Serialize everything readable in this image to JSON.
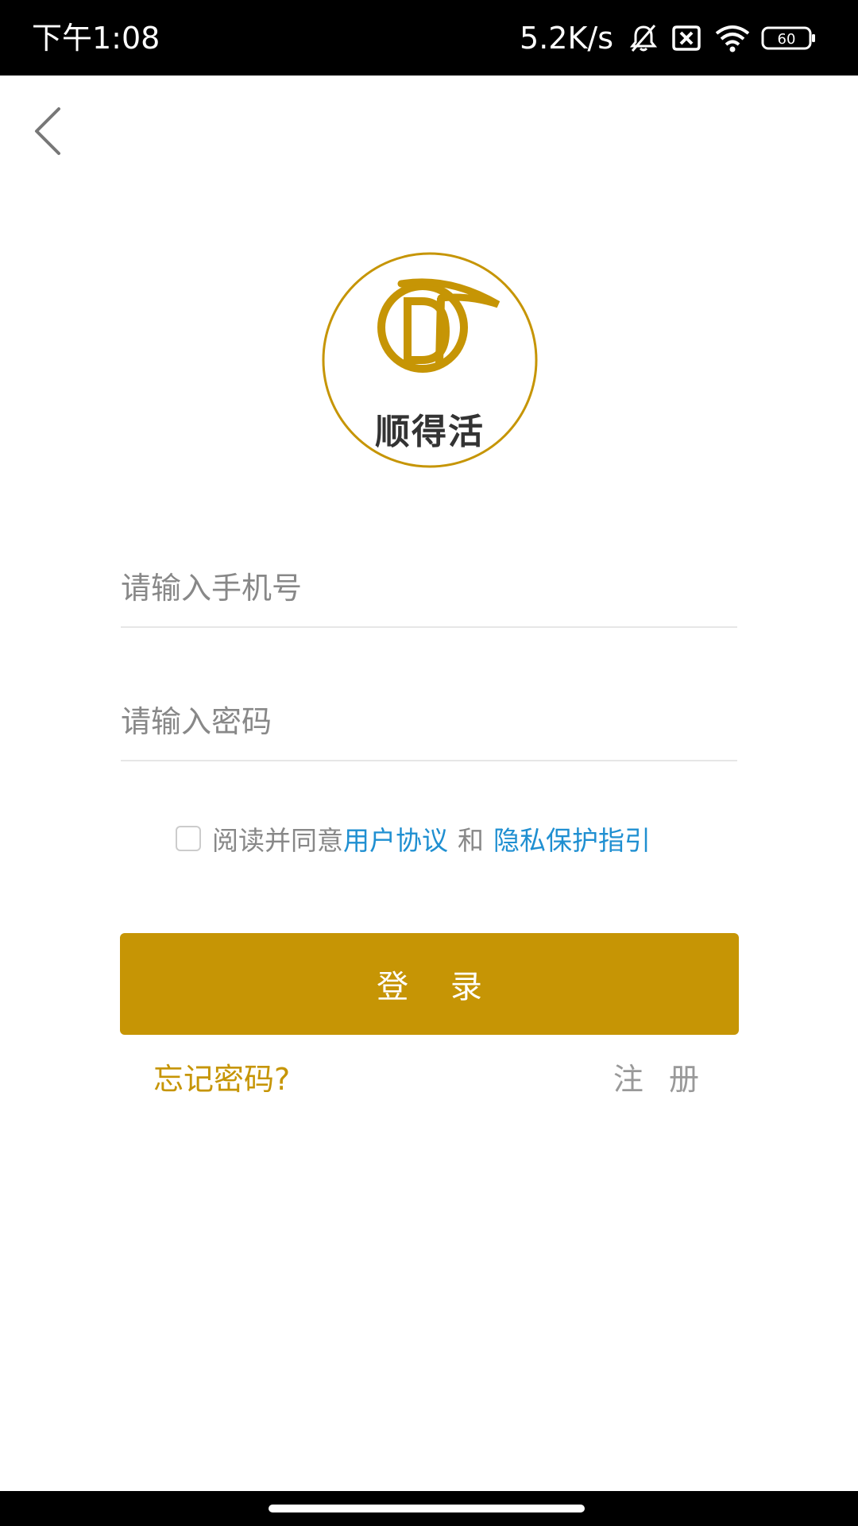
{
  "status_bar": {
    "time": "下午1:08",
    "net_speed": "5.2K/s",
    "battery": "60",
    "icons": [
      "bell-off-icon",
      "sim-none-icon",
      "wifi-icon",
      "battery-icon"
    ]
  },
  "nav": {
    "back_icon": "chevron-left-icon"
  },
  "logo": {
    "brand_text": "顺得活",
    "color": "#c69505"
  },
  "form": {
    "phone_placeholder": "请输入手机号",
    "password_placeholder": "请输入密码"
  },
  "agreement": {
    "prefix": "阅读并同意",
    "user_agreement": "用户协议",
    "and": "和",
    "privacy_guide": "隐私保护指引"
  },
  "login_button": "登 录",
  "forgot_password": "忘记密码?",
  "register": "注 册",
  "colors": {
    "accent": "#c69505",
    "link": "#1f8fd1",
    "muted": "#888888"
  }
}
